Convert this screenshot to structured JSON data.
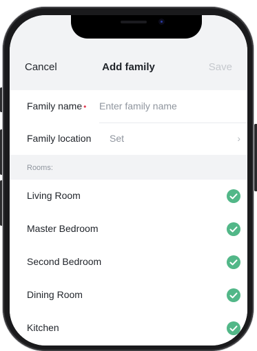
{
  "nav": {
    "cancel": "Cancel",
    "title": "Add family",
    "save": "Save"
  },
  "form": {
    "family_name_label": "Family name",
    "required_mark": "•",
    "family_name_placeholder": "Enter family name",
    "family_location_label": "Family location",
    "family_location_value": "Set"
  },
  "rooms": {
    "header": "Rooms:",
    "items": [
      {
        "name": "Living Room",
        "checked": true
      },
      {
        "name": "Master Bedroom",
        "checked": true
      },
      {
        "name": "Second Bedroom",
        "checked": true
      },
      {
        "name": "Dining Room",
        "checked": true
      },
      {
        "name": "Kitchen",
        "checked": true
      }
    ]
  },
  "colors": {
    "accent_check": "#52b788",
    "required": "#e0394f",
    "background": "#f2f3f5"
  }
}
